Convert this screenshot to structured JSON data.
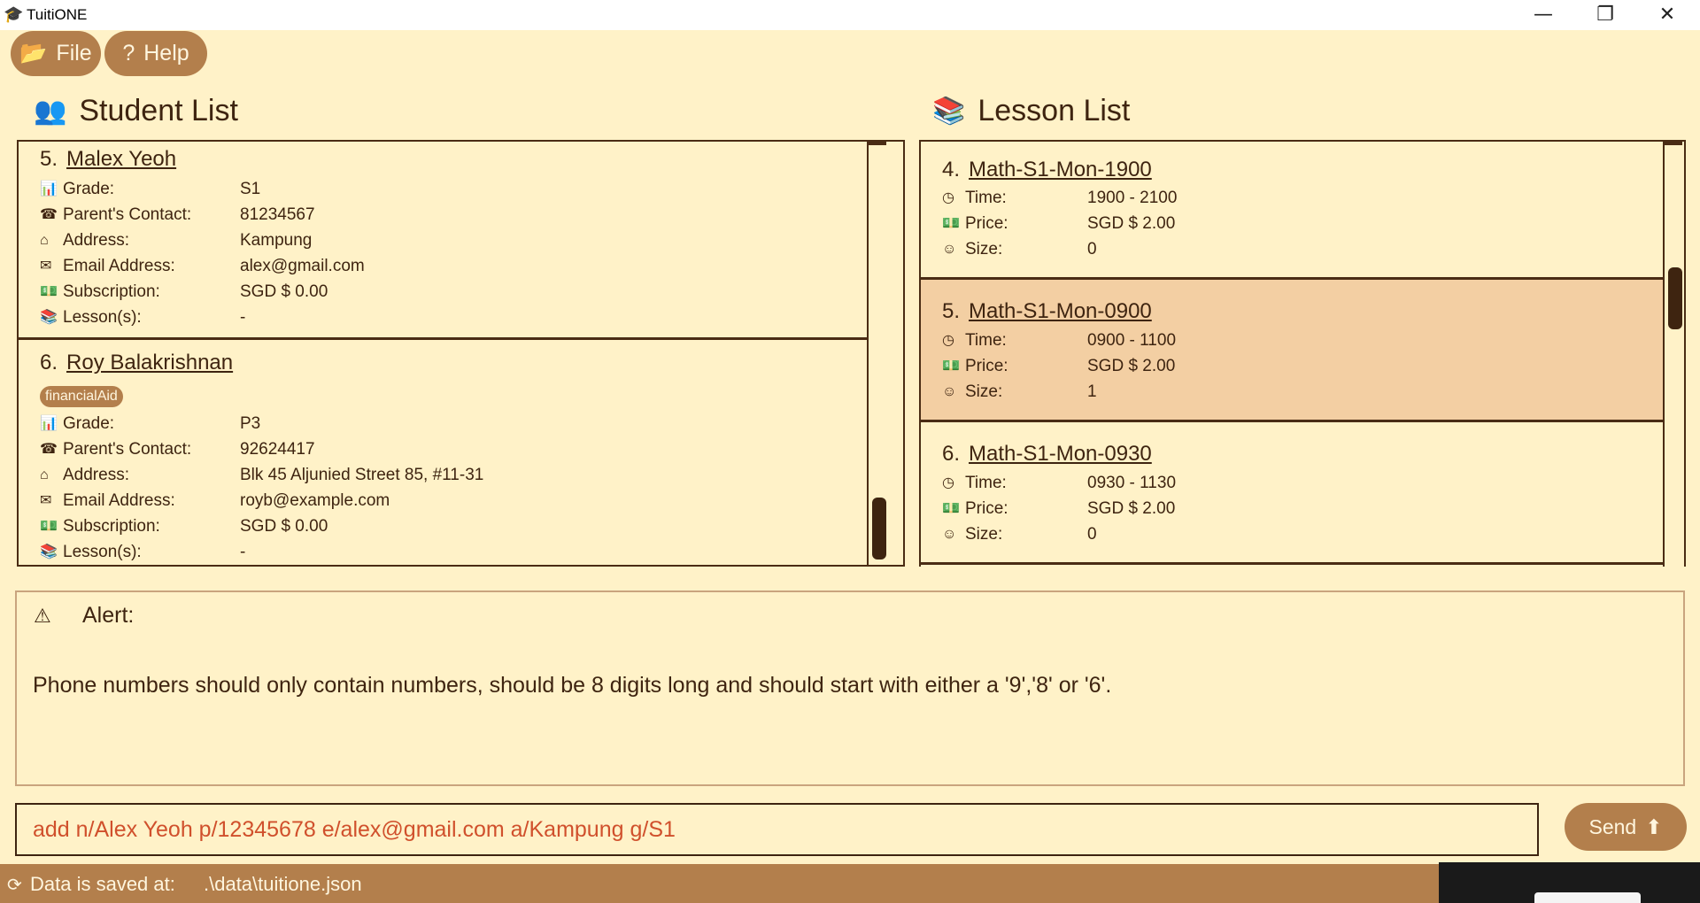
{
  "window": {
    "title": "TuitiONE",
    "minimize": "—",
    "restore": "❐",
    "close": "✕",
    "app_icon": "graduation-cap-icon"
  },
  "menu": {
    "file_label": "File",
    "help_label": "Help",
    "file_icon": "folder-icon",
    "help_icon": "question-icon"
  },
  "students": {
    "title": "Student List",
    "labels": {
      "grade": "Grade:",
      "contact": "Parent's Contact:",
      "address": "Address:",
      "email": "Email Address:",
      "subscription": "Subscription:",
      "lessons": "Lesson(s):"
    },
    "items": [
      {
        "index": "5.",
        "name": "Malex Yeoh",
        "tag": "",
        "grade": "S1",
        "contact": "81234567",
        "address": "Kampung",
        "email": "alex@gmail.com",
        "subscription": "SGD $ 0.00",
        "lessons": "-"
      },
      {
        "index": "6.",
        "name": "Roy Balakrishnan",
        "tag": "financialAid",
        "grade": "P3",
        "contact": "92624417",
        "address": "Blk 45 Aljunied Street 85, #11-31",
        "email": "royb@example.com",
        "subscription": "SGD $ 0.00",
        "lessons": "-"
      }
    ]
  },
  "lessons": {
    "title": "Lesson List",
    "labels": {
      "time": "Time:",
      "price": "Price:",
      "size": "Size:"
    },
    "items": [
      {
        "index": "4.",
        "name": "Math-S1-Mon-1900",
        "time": "1900 - 2100",
        "price": "SGD $ 2.00",
        "size": "0",
        "selected": false
      },
      {
        "index": "5.",
        "name": "Math-S1-Mon-0900",
        "time": "0900 - 1100",
        "price": "SGD $ 2.00",
        "size": "1",
        "selected": true
      },
      {
        "index": "6.",
        "name": "Math-S1-Mon-0930",
        "time": "0930 - 1130",
        "price": "SGD $ 2.00",
        "size": "0",
        "selected": false
      }
    ]
  },
  "alert": {
    "title": "Alert:",
    "message": "Phone numbers should only contain numbers, should be 8 digits long and should start with either a '9','8' or '6'."
  },
  "command": {
    "value": "add n/Alex Yeoh p/12345678 e/alex@gmail.com a/Kampung g/S1",
    "send_label": "Send"
  },
  "status": {
    "label": "Data is saved at:",
    "path": ".\\data\\tuitione.json"
  },
  "colors": {
    "background": "#fff2c8",
    "accent": "#b37f4c",
    "selected": "#f3cfa3",
    "text": "#3e2410",
    "command_text": "#d0502c"
  }
}
